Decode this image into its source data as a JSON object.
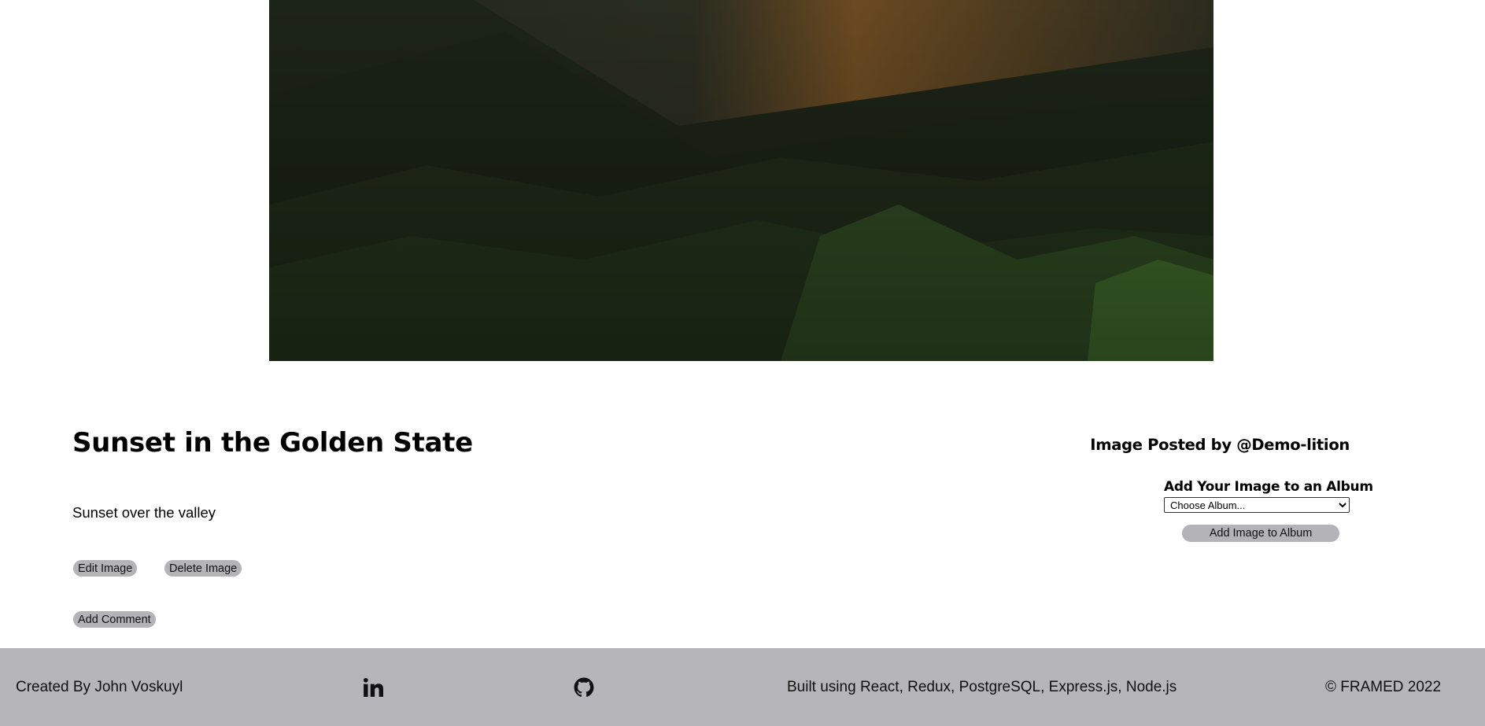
{
  "image": {
    "title": "Sunset in the Golden State",
    "description": "Sunset over the valley",
    "posted_by": "Image Posted by @Demo-lition"
  },
  "album": {
    "heading": "Add Your Image to an Album",
    "select_value": "Choose Album...",
    "add_button_label": "Add Image to Album"
  },
  "actions": {
    "edit_label": "Edit Image",
    "delete_label": "Delete Image",
    "comment_label": "Add Comment"
  },
  "footer": {
    "credit": "Created By John Voskuyl",
    "built_with": "Built using React, Redux, PostgreSQL, Express.js, Node.js",
    "copyright": "© FRAMED 2022",
    "icons": [
      "linkedin-icon",
      "github-icon"
    ]
  },
  "colors": {
    "button_bg": "#b4b4b8",
    "footer_bg": "#b5b5ba"
  }
}
